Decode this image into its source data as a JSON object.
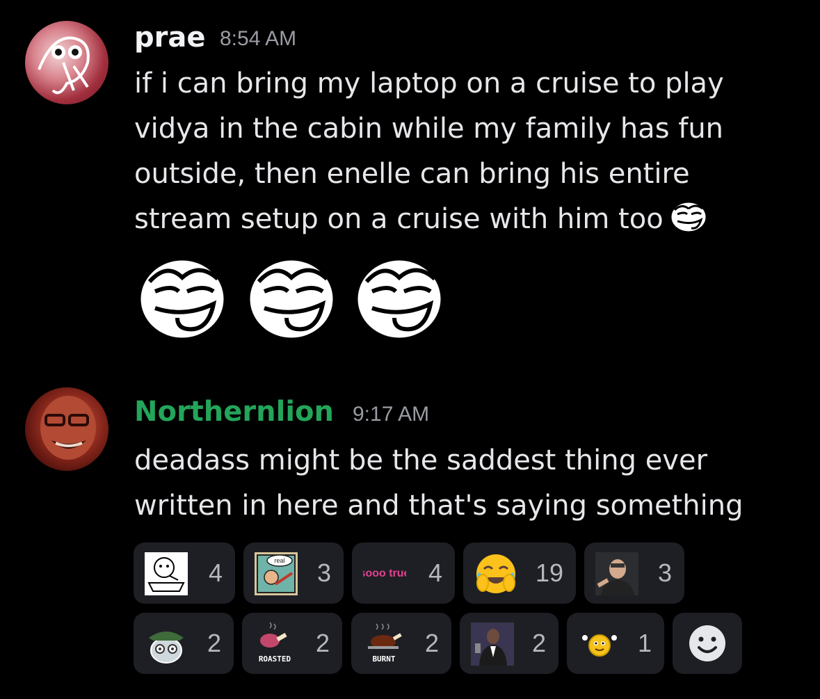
{
  "messages": [
    {
      "author": "prae",
      "timestamp": "8:54 AM",
      "lines": [
        "if i can bring my laptop on a cruise to play",
        "vidya in the cabin while my family has fun",
        "outside, then enelle can bring his entire",
        "stream setup on a cruise with him too"
      ],
      "inline_emoji": "troll-face-emoji",
      "big_emojis": [
        "troll-face-emoji",
        "troll-face-emoji",
        "troll-face-emoji"
      ]
    },
    {
      "author": "Northernlion",
      "author_color": "#23a55a",
      "timestamp": "9:17 AM",
      "lines": [
        "deadass might be the saddest thing ever",
        "written in here and that's saying something"
      ]
    }
  ],
  "reactions": [
    {
      "emoji": "cereal-guy-emoji",
      "count": "4"
    },
    {
      "emoji": "real-comic-emoji",
      "label": "real",
      "count": "3"
    },
    {
      "emoji": "sooo-true-emoji",
      "label": "sooo true",
      "count": "4"
    },
    {
      "emoji": "crying-laughing-emoji",
      "count": "19"
    },
    {
      "emoji": "streamer-face-emoji",
      "count": "3"
    },
    {
      "emoji": "green-hat-cat-emoji",
      "count": "2"
    },
    {
      "emoji": "roasted-ham-emoji",
      "label": "ROASTED",
      "count": "2"
    },
    {
      "emoji": "burnt-turkey-emoji",
      "label": "BURNT",
      "count": "2"
    },
    {
      "emoji": "suit-man-emoji",
      "count": "2"
    },
    {
      "emoji": "smiley-hands-up-emoji",
      "count": "1"
    }
  ],
  "colors": {
    "background": "#000000",
    "reaction_bg": "#1e1f24",
    "timestamp": "#9a9ca3",
    "author_highlight": "#23a55a"
  },
  "icons": [
    "smile-icon"
  ]
}
